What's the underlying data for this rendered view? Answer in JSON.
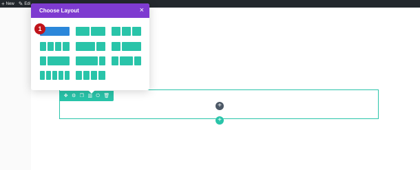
{
  "adminbar": {
    "new_label": "New",
    "edit_label": "Edi"
  },
  "modal": {
    "title": "Choose Layout",
    "close_glyph": "×"
  },
  "badge": {
    "number": "1"
  },
  "layouts": [
    {
      "name": "1",
      "selected": true
    },
    {
      "name": "1/2 + 1/2"
    },
    {
      "name": "1/3 + 1/3 + 1/3"
    },
    {
      "name": "1/4 + 1/4 + 1/4 + 1/4"
    },
    {
      "name": "2/3 + 1/3"
    },
    {
      "name": "1/3 + 2/3"
    },
    {
      "name": "1/4 + 3/4"
    },
    {
      "name": "3/4 + 1/4"
    },
    {
      "name": "1/4 + 1/2 + 1/4"
    },
    {
      "name": "1/5 x 5"
    },
    {
      "name": "1/6 x 6"
    }
  ],
  "row_toolbar": {
    "icons": [
      "move-icon",
      "settings-icon",
      "duplicate-icon",
      "columns-icon",
      "power-icon",
      "trash-icon"
    ]
  },
  "add_module_glyph": "+",
  "add_row_glyph": "+",
  "colors": {
    "header": "#7e3bd0",
    "accent": "#29c4a9",
    "selected": "#2b87da",
    "badge": "#c0141b",
    "adminbar": "#23282d"
  }
}
